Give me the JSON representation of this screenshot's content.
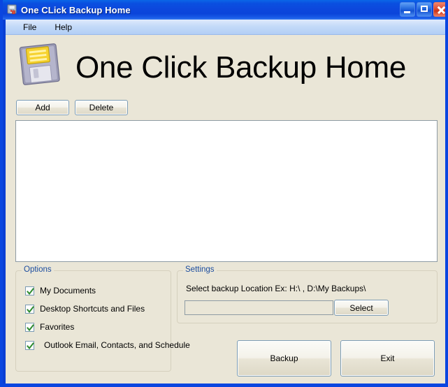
{
  "window": {
    "title": "One CLick Backup Home",
    "icon": "app-floppy-icon",
    "controls": {
      "minimize": "minimize-button",
      "maximize": "maximize-button",
      "close": "close-button"
    }
  },
  "menubar": {
    "items": [
      {
        "label": "File"
      },
      {
        "label": "Help"
      }
    ]
  },
  "header": {
    "logo_icon": "floppy-disk-icon",
    "heading": "One Click Backup Home"
  },
  "toolbar": {
    "add_label": "Add",
    "delete_label": "Delete"
  },
  "list": {
    "items": []
  },
  "options": {
    "title": "Options",
    "items": [
      {
        "label": "My Documents",
        "checked": true
      },
      {
        "label": "Desktop Shortcuts and Files",
        "checked": true
      },
      {
        "label": "Favorites",
        "checked": true
      },
      {
        "label": "Outlook Email, Contacts, and Schedule",
        "checked": true
      }
    ]
  },
  "settings": {
    "title": "Settings",
    "hint": "Select backup Location Ex: H:\\  , D:\\My Backups\\",
    "path_value": "",
    "path_placeholder": "",
    "select_label": "Select"
  },
  "actions": {
    "backup_label": "Backup",
    "exit_label": "Exit"
  },
  "colors": {
    "form_background": "#EAE6D7",
    "titlebar_blue": "#0B48DC",
    "group_title_blue": "#1B4C9E",
    "check_green": "#2E8B2E",
    "close_red": "#CC3418"
  }
}
